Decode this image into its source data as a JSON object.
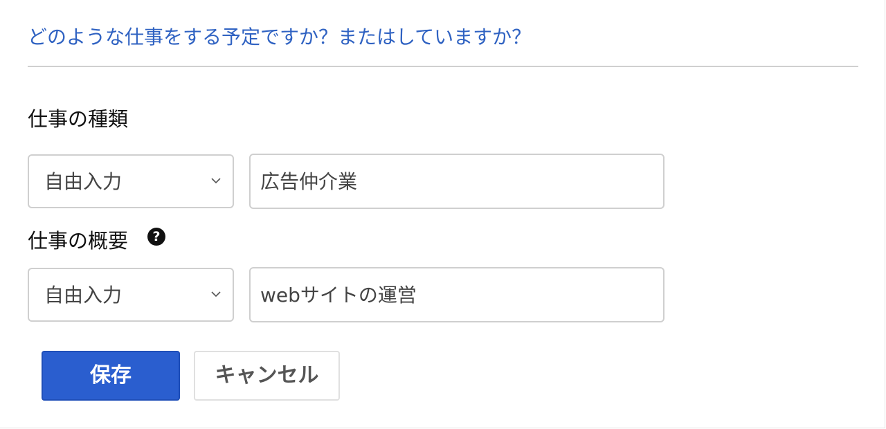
{
  "heading": "どのような仕事をする予定ですか？またはしていますか？",
  "job_type": {
    "label": "仕事の種類",
    "select_value": "自由入力",
    "input_value": "広告仲介業"
  },
  "job_summary": {
    "label": "仕事の概要",
    "help_icon": "?",
    "select_value": "自由入力",
    "input_value": "webサイトの運営"
  },
  "buttons": {
    "save_label": "保存",
    "cancel_label": "キャンセル"
  },
  "colors": {
    "accent": "#2f62c2",
    "primary_button": "#2a5ecf"
  },
  "icons": {
    "help": "question-circle-icon",
    "dropdown": "chevron-down-icon"
  }
}
